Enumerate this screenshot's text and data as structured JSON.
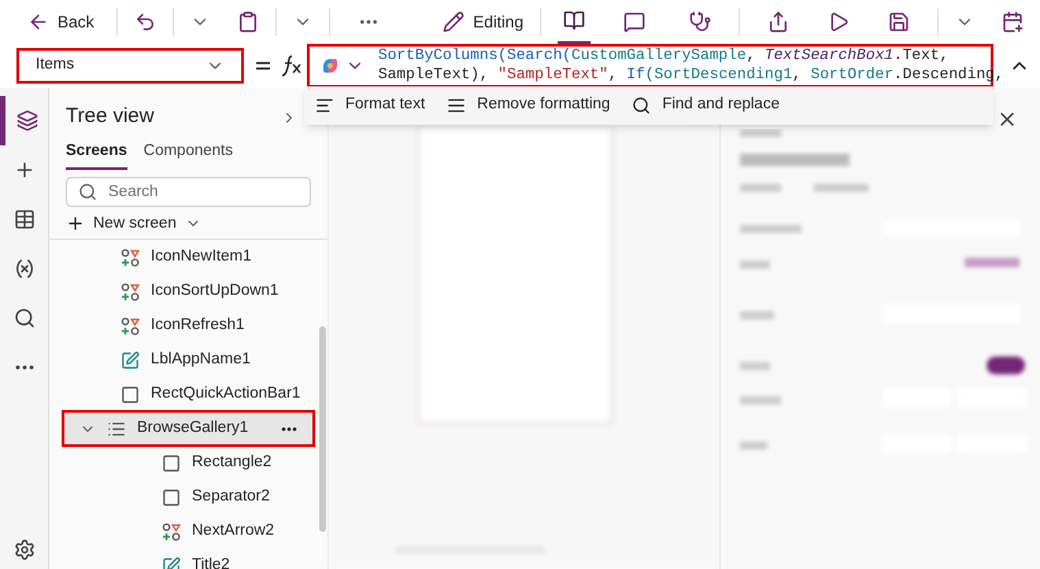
{
  "toolbar": {
    "back": "Back",
    "mode": "Editing"
  },
  "property_selector": {
    "value": "Items"
  },
  "formula": {
    "lines": [
      [
        {
          "text": "SortByColumns(",
          "kind": "function"
        },
        {
          "text": "Search(",
          "kind": "function"
        },
        {
          "text": "CustomGallerySample",
          "kind": "source"
        },
        {
          "text": ", ",
          "kind": "plain"
        },
        {
          "text": "TextSearchBox1",
          "kind": "control"
        },
        {
          "text": ".Text,",
          "kind": "plain"
        }
      ],
      [
        {
          "text": "SampleText), ",
          "kind": "plain"
        },
        {
          "text": "\"SampleText\"",
          "kind": "string"
        },
        {
          "text": ", ",
          "kind": "plain"
        },
        {
          "text": "If(",
          "kind": "function"
        },
        {
          "text": "SortDescending1",
          "kind": "source"
        },
        {
          "text": ", ",
          "kind": "plain"
        },
        {
          "text": "SortOrder",
          "kind": "source"
        },
        {
          "text": ".Descending,",
          "kind": "plain"
        }
      ]
    ]
  },
  "format_tools": [
    {
      "label": "Format text",
      "kind": "format"
    },
    {
      "label": "Remove formatting",
      "kind": "remove"
    },
    {
      "label": "Find and replace",
      "kind": "find"
    }
  ],
  "rail": [
    {
      "kind": "layers",
      "selected": true
    },
    {
      "kind": "insert",
      "selected": false
    },
    {
      "kind": "data",
      "selected": false
    },
    {
      "kind": "variables",
      "selected": false
    },
    {
      "kind": "search",
      "selected": false
    },
    {
      "kind": "more",
      "selected": false
    }
  ],
  "tree": {
    "title": "Tree view",
    "tabs": [
      {
        "label": "Screens",
        "selected": true
      },
      {
        "label": "Components",
        "selected": false
      }
    ],
    "search": {
      "placeholder": "Search"
    },
    "new_screen": "New screen",
    "items": [
      {
        "label": "IconNewItem1",
        "kind": "icon",
        "selected": false
      },
      {
        "label": "IconSortUpDown1",
        "kind": "icon",
        "selected": false
      },
      {
        "label": "IconRefresh1",
        "kind": "icon",
        "selected": false
      },
      {
        "label": "LblAppName1",
        "kind": "label",
        "selected": false
      },
      {
        "label": "RectQuickActionBar1",
        "kind": "rectangle",
        "selected": false
      },
      {
        "label": "BrowseGallery1",
        "kind": "gallery",
        "selected": true,
        "expanded": true,
        "children": [
          {
            "label": "Rectangle2",
            "kind": "rectangle",
            "selected": false
          },
          {
            "label": "Separator2",
            "kind": "rectangle",
            "selected": false
          },
          {
            "label": "NextArrow2",
            "kind": "icon",
            "selected": false
          },
          {
            "label": "Title2",
            "kind": "label",
            "selected": false
          }
        ]
      }
    ]
  }
}
